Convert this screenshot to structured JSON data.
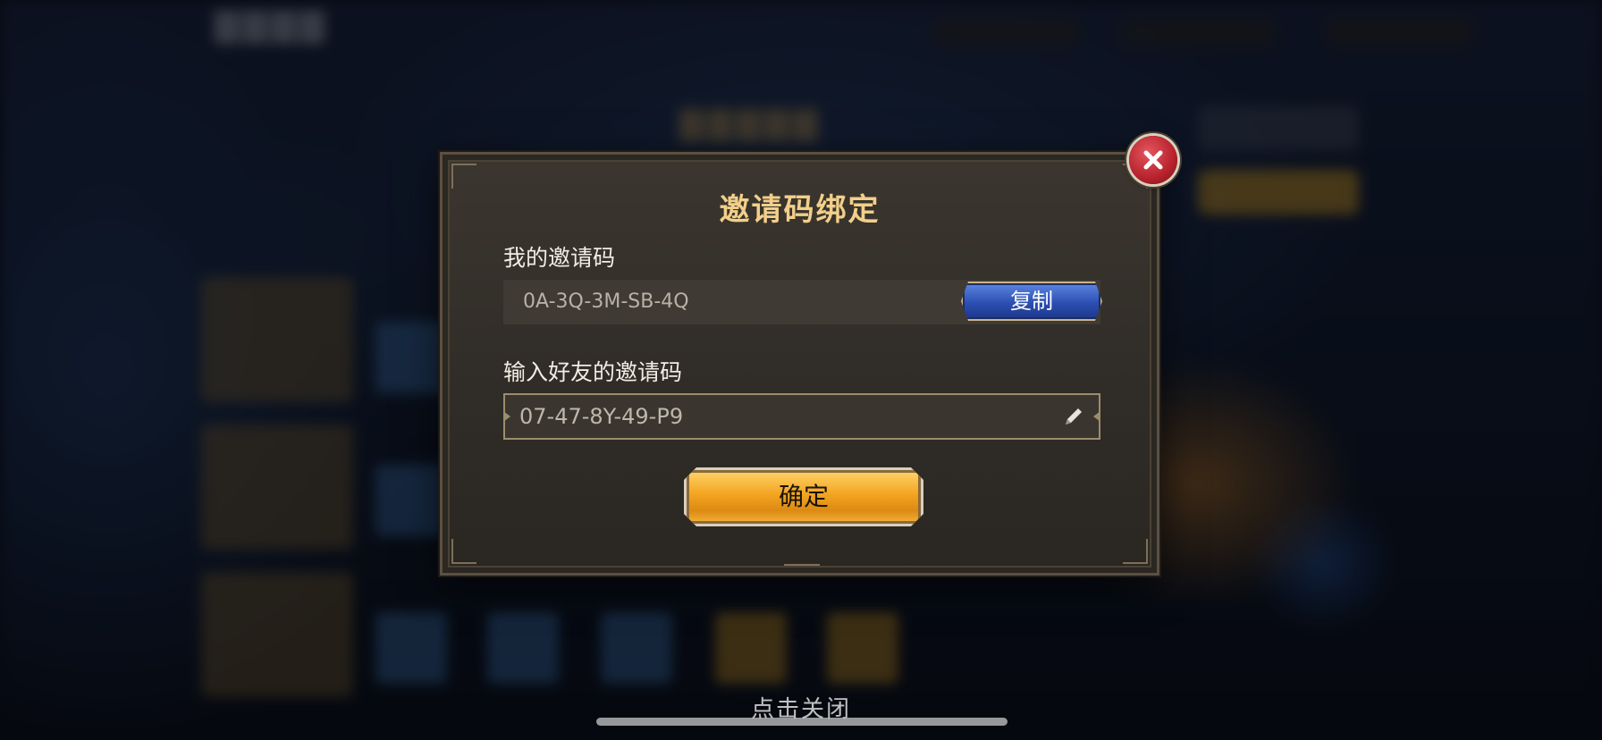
{
  "dialog": {
    "title": "邀请码绑定",
    "my_code_label": "我的邀请码",
    "my_code_value": "0A-3Q-3M-SB-4Q",
    "copy_label": "复制",
    "friend_code_label": "输入好友的邀请码",
    "friend_code_value": "07-47-8Y-49-P9",
    "confirm_label": "确定",
    "close_icon": "close-icon",
    "edit_icon": "pencil-icon"
  },
  "footer": {
    "tap_to_close": "点击关闭"
  },
  "colors": {
    "title": "#f2cf8a",
    "copy_button": "#2c4fb3",
    "confirm_button": "#f3a521",
    "close_button": "#b8222c",
    "panel": "#312d28"
  }
}
